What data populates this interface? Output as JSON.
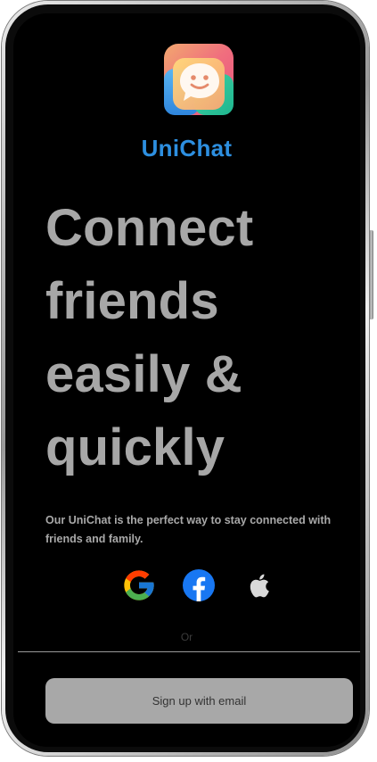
{
  "app": {
    "name": "UniChat"
  },
  "hero": {
    "line1": "Connect",
    "line2": "friends",
    "line3": "easily &",
    "line4": "quickly"
  },
  "subtitle": "Our UniChat is the perfect way to stay connected with friends and family.",
  "social": [
    {
      "name": "google",
      "icon": "google-icon"
    },
    {
      "name": "facebook",
      "icon": "facebook-icon"
    },
    {
      "name": "apple",
      "icon": "apple-icon"
    }
  ],
  "divider_text": "Or",
  "email_button_label": "Sign up with email",
  "colors": {
    "background": "#000000",
    "brand": "#2d8fe0",
    "headline": "#a7a7a7",
    "button": "#a8a8a8"
  }
}
